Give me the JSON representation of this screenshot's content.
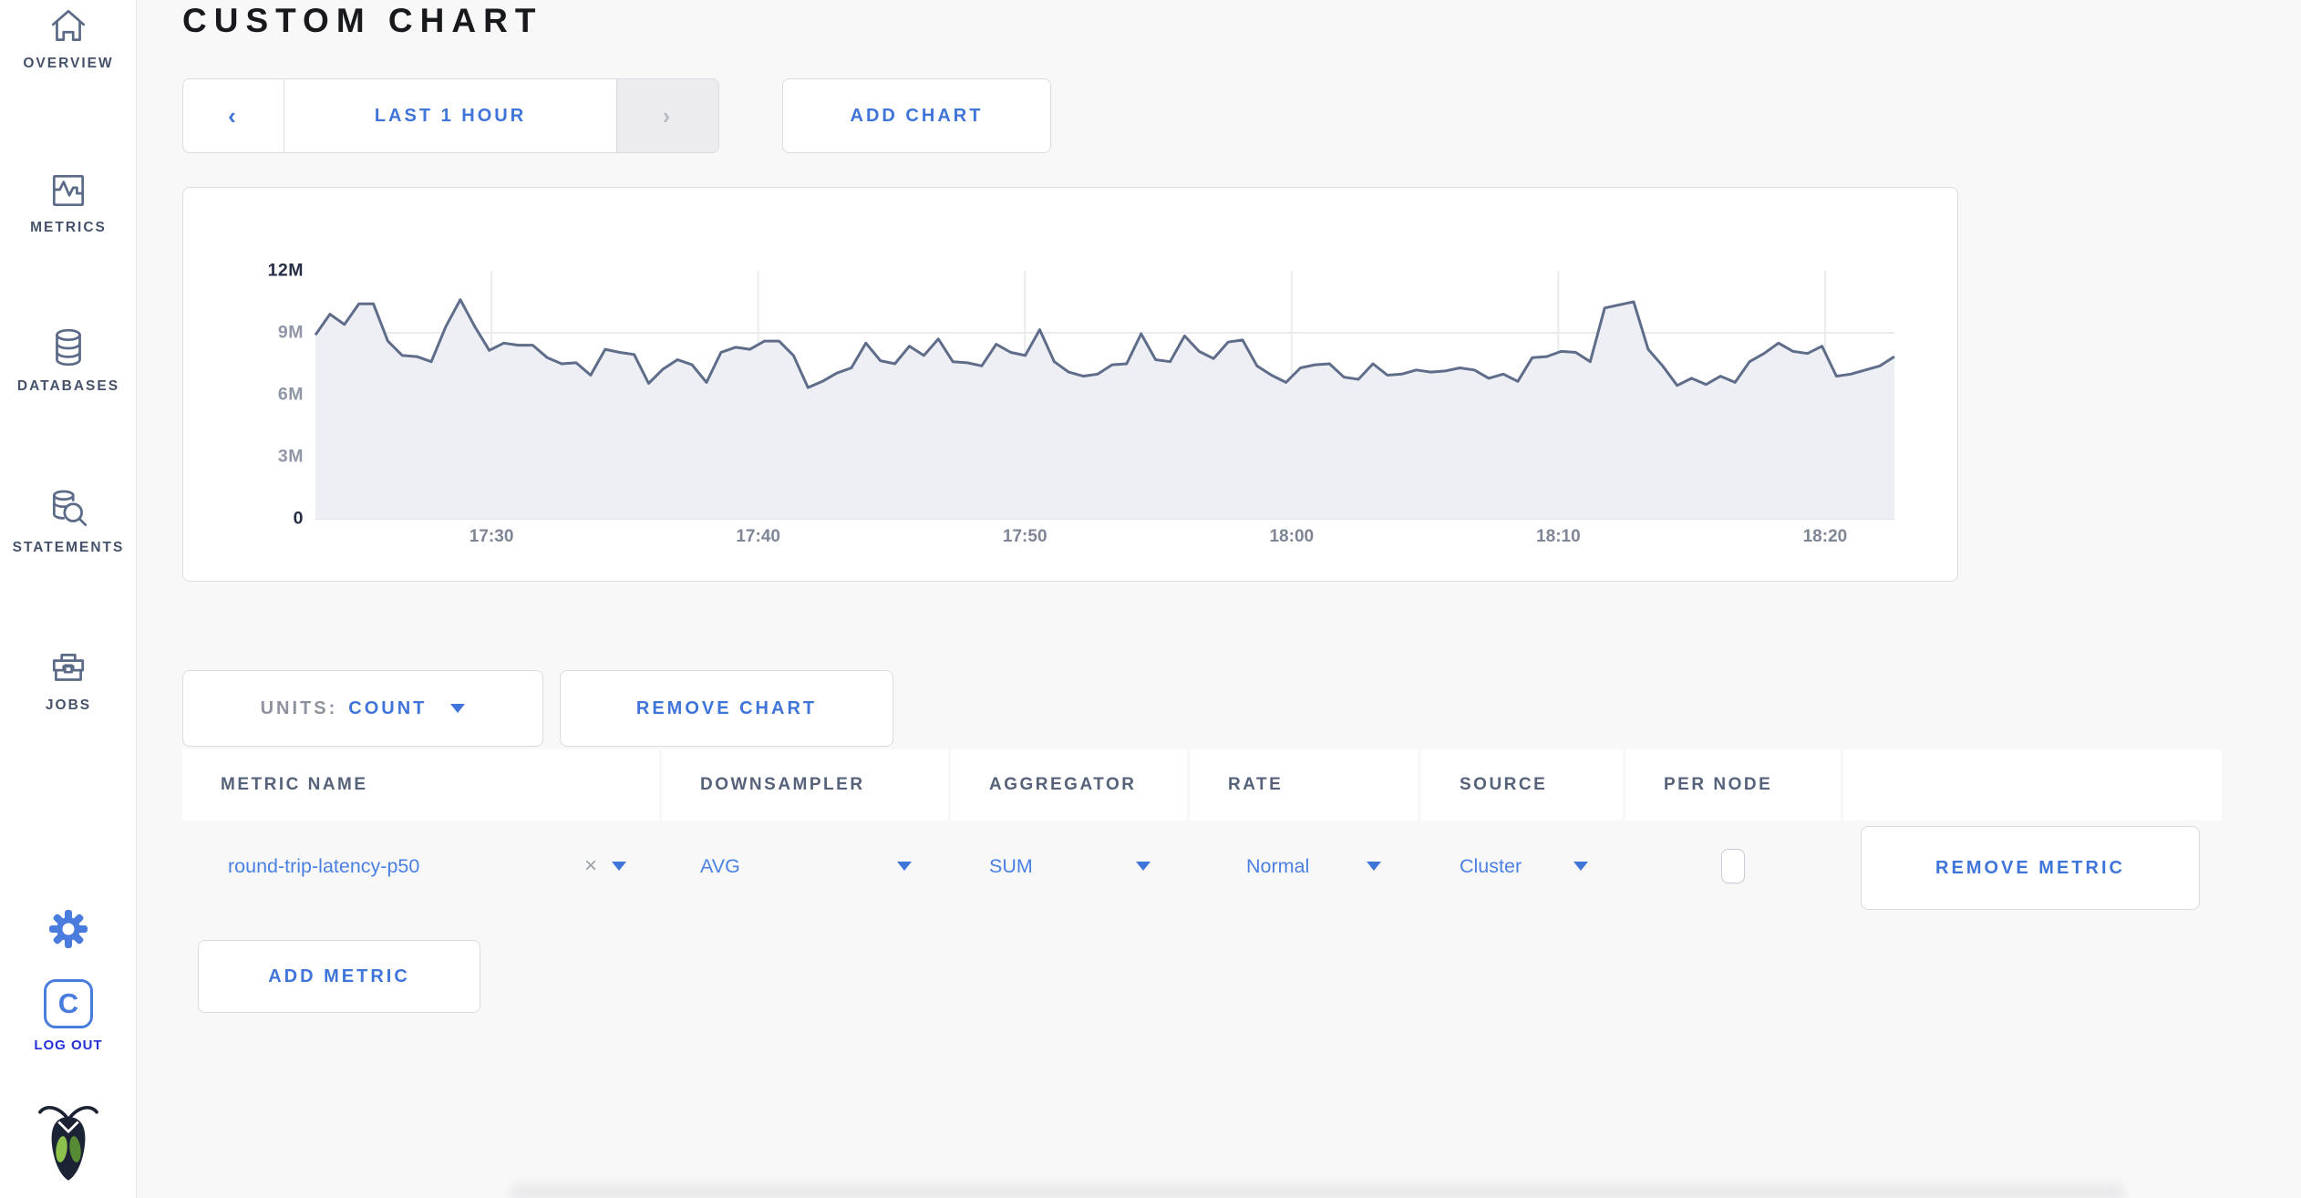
{
  "header": {
    "title": "CUSTOM CHART"
  },
  "sidebar": {
    "items": [
      {
        "label": "OVERVIEW"
      },
      {
        "label": "METRICS"
      },
      {
        "label": "DATABASES"
      },
      {
        "label": "STATEMENTS"
      },
      {
        "label": "JOBS"
      }
    ],
    "logout": {
      "monogram": "C",
      "label": "LOG OUT"
    }
  },
  "toolbar": {
    "prev_glyph": "‹",
    "time_range_label": "LAST 1 HOUR",
    "next_glyph": "›",
    "add_chart_label": "ADD CHART"
  },
  "chart_controls": {
    "units_prefix": "UNITS:",
    "units_value": "COUNT",
    "remove_chart_label": "REMOVE CHART",
    "add_metric_label": "ADD METRIC"
  },
  "metrics_table": {
    "headers": [
      "METRIC NAME",
      "DOWNSAMPLER",
      "AGGREGATOR",
      "RATE",
      "SOURCE",
      "PER NODE",
      ""
    ],
    "rows": [
      {
        "metric_name": "round-trip-latency-p50",
        "clear_glyph": "×",
        "downsampler": "AVG",
        "aggregator": "SUM",
        "rate": "Normal",
        "source": "Cluster",
        "per_node_checked": false,
        "remove_label": "REMOVE METRIC"
      }
    ]
  },
  "colors": {
    "accent_blue": "#3f74d9",
    "row_blue": "#4a80e2",
    "line": "#5f6d8a",
    "area_fill": "#edeff4",
    "gridline": "#ebebee",
    "axis_line": "#e3e3e7"
  },
  "chart_data": {
    "type": "area",
    "title": "",
    "unit": "count",
    "legend": false,
    "grid": true,
    "x_ticks": [
      "17:30",
      "17:40",
      "17:50",
      "18:00",
      "18:10",
      "18:20"
    ],
    "x_range_minutes": [
      1043.4,
      1102.6
    ],
    "y_max": 12000000,
    "y_ticks": [
      {
        "value": 0,
        "label": "0"
      },
      {
        "value": 3000000,
        "label": "3M"
      },
      {
        "value": 6000000,
        "label": "6M"
      },
      {
        "value": 9000000,
        "label": "9M"
      },
      {
        "value": 12000000,
        "label": "12M"
      }
    ],
    "series": [
      {
        "name": "round-trip-latency-p50",
        "color": "#5f6d8a",
        "fill": "#edeff4",
        "values_millions": [
          8.9,
          9.9,
          9.4,
          10.4,
          10.4,
          8.6,
          7.9,
          7.85,
          7.6,
          9.3,
          10.6,
          9.3,
          8.15,
          8.5,
          8.4,
          8.4,
          7.8,
          7.5,
          7.55,
          6.95,
          8.2,
          8.05,
          7.95,
          6.55,
          7.25,
          7.7,
          7.45,
          6.6,
          8.05,
          8.3,
          8.2,
          8.6,
          8.6,
          7.9,
          6.35,
          6.65,
          7.05,
          7.3,
          8.5,
          7.65,
          7.5,
          8.35,
          7.9,
          8.7,
          7.6,
          7.55,
          7.4,
          8.45,
          8.05,
          7.9,
          9.15,
          7.6,
          7.1,
          6.9,
          7.0,
          7.45,
          7.5,
          8.95,
          7.7,
          7.6,
          8.85,
          8.1,
          7.75,
          8.55,
          8.65,
          7.4,
          6.95,
          6.6,
          7.3,
          7.45,
          7.5,
          6.85,
          6.75,
          7.5,
          6.95,
          7.0,
          7.2,
          7.1,
          7.15,
          7.3,
          7.2,
          6.8,
          7.0,
          6.65,
          7.8,
          7.85,
          8.1,
          8.05,
          7.6,
          10.2,
          10.35,
          10.5,
          8.2,
          7.4,
          6.45,
          6.8,
          6.5,
          6.9,
          6.6,
          7.6,
          8.0,
          8.5,
          8.1,
          8.0,
          8.35,
          6.9,
          7.0,
          7.2,
          7.4,
          7.85
        ]
      }
    ]
  }
}
